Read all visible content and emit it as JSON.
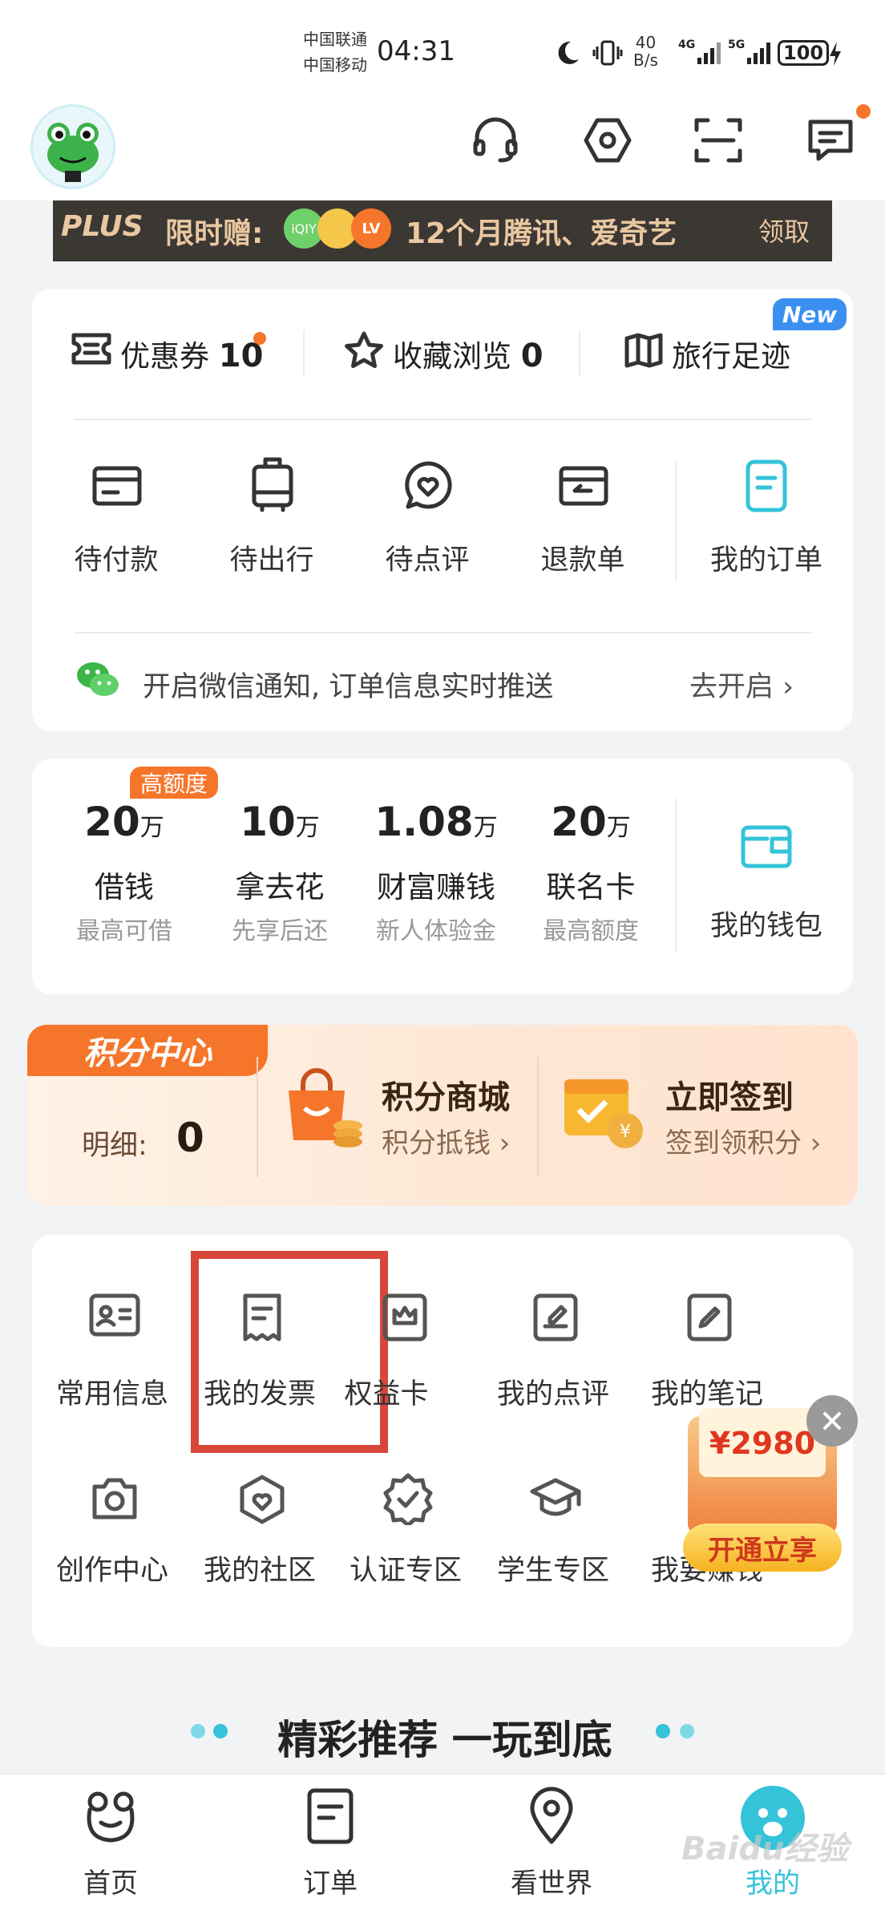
{
  "status_bar": {
    "carrier1": "中国联通",
    "carrier2": "中国移动",
    "time": "04:31",
    "net_speed_value": "40",
    "net_speed_unit": "B/s",
    "signal1": "4G",
    "signal2": "5G",
    "battery": "100"
  },
  "header": {
    "icons": [
      "headset-icon",
      "settings-hex-icon",
      "scan-icon",
      "message-icon"
    ]
  },
  "banner": {
    "plus": "PLUS",
    "promo": "限时赠:",
    "app_badges": [
      "iQIY",
      "LV"
    ],
    "text": "12个月腾讯、爱奇艺",
    "action": "领取"
  },
  "quick_row": {
    "coupons_label": "优惠券",
    "coupons_count": "10",
    "favorites_label": "收藏浏览",
    "favorites_count": "0",
    "travel_label": "旅行足迹",
    "new_badge": "New"
  },
  "orders": [
    {
      "label": "待付款",
      "icon": "card-icon"
    },
    {
      "label": "待出行",
      "icon": "luggage-icon"
    },
    {
      "label": "待点评",
      "icon": "review-heart-icon"
    },
    {
      "label": "退款单",
      "icon": "refund-icon"
    },
    {
      "label": "我的订单",
      "icon": "order-doc-icon"
    }
  ],
  "wechat_notice": {
    "text": "开启微信通知, 订单信息实时推送",
    "action": "去开启"
  },
  "finance": {
    "badge": "高额度",
    "items": [
      {
        "amount": "20",
        "unit": "万",
        "title": "借钱",
        "sub": "最高可借"
      },
      {
        "amount": "10",
        "unit": "万",
        "title": "拿去花",
        "sub": "先享后还"
      },
      {
        "amount": "1.08",
        "unit": "万",
        "title": "财富赚钱",
        "sub": "新人体验金"
      },
      {
        "amount": "20",
        "unit": "万",
        "title": "联名卡",
        "sub": "最高额度"
      }
    ],
    "wallet_label": "我的钱包"
  },
  "points": {
    "title": "积分中心",
    "detail_label": "明细:",
    "detail_value": "0",
    "mall_title": "积分商城",
    "mall_sub": "积分抵钱",
    "signin_title": "立即签到",
    "signin_sub": "签到领积分"
  },
  "services": [
    {
      "label": "常用信息",
      "icon": "id-card-icon"
    },
    {
      "label": "我的发票",
      "icon": "invoice-icon"
    },
    {
      "label": "权益卡",
      "icon": "crown-card-icon"
    },
    {
      "label": "我的点评",
      "icon": "pen-doc-icon"
    },
    {
      "label": "我的笔记",
      "icon": "note-pen-icon"
    },
    {
      "label": "创作中心",
      "icon": "camera-icon"
    },
    {
      "label": "我的社区",
      "icon": "community-heart-icon"
    },
    {
      "label": "认证专区",
      "icon": "verified-badge-icon"
    },
    {
      "label": "学生专区",
      "icon": "graduation-cap-icon"
    },
    {
      "label": "我要赚钱",
      "icon": "money-icon"
    }
  ],
  "promo_float": {
    "amount": "¥2980",
    "button": "开通立享"
  },
  "recommend": {
    "title": "精彩推荐 一玩到底"
  },
  "bottom_nav": [
    {
      "label": "首页",
      "icon": "frog-home-icon"
    },
    {
      "label": "订单",
      "icon": "order-tab-icon"
    },
    {
      "label": "看世界",
      "icon": "location-pin-icon"
    },
    {
      "label": "我的",
      "icon": "my-paw-icon"
    }
  ],
  "watermark": "Baidu经验",
  "colors": {
    "accent_teal": "#34c3d9",
    "orange": "#f5762a",
    "highlight_red": "#d9473a",
    "badge_blue": "#3b8ff0"
  }
}
